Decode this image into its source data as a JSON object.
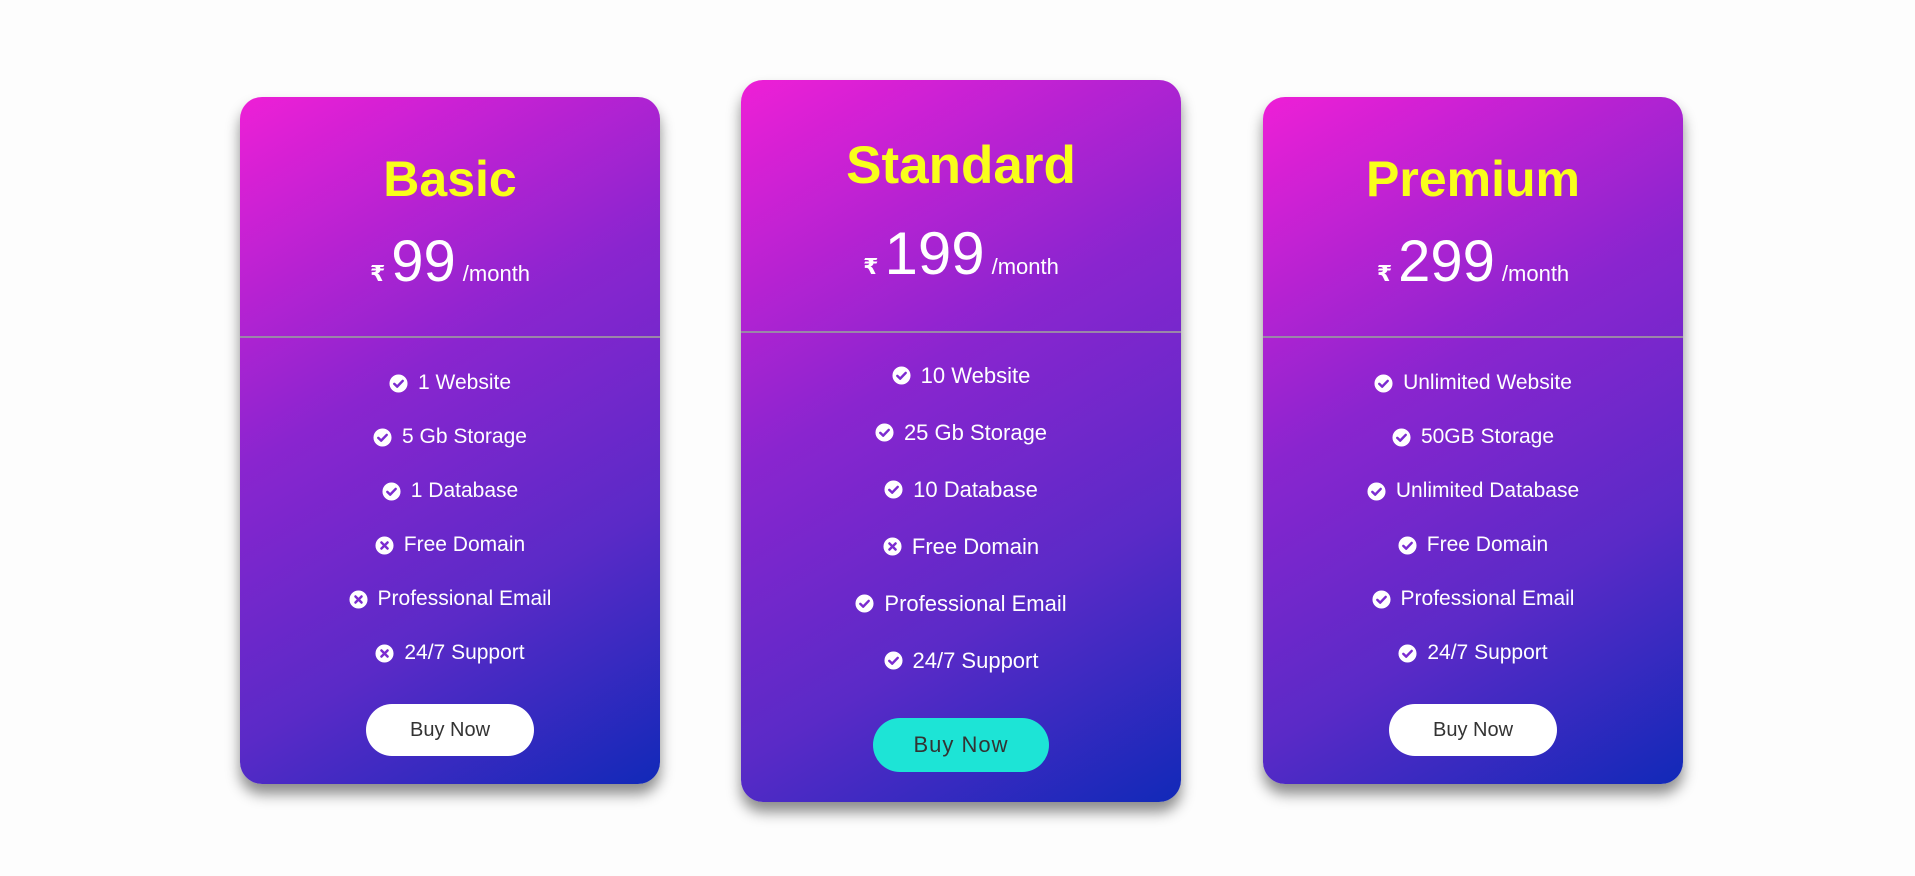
{
  "theme": {
    "gradient_start": "#ee1fd6",
    "gradient_end": "#1129b8",
    "title_color": "#f9ff1a",
    "highlight_button_color": "#1de4d6"
  },
  "plans": [
    {
      "name": "Basic",
      "currency": "₹",
      "price": "99",
      "period": "/month",
      "features": [
        {
          "label": "1 Website",
          "included": true
        },
        {
          "label": "5 Gb Storage",
          "included": true
        },
        {
          "label": "1 Database",
          "included": true
        },
        {
          "label": "Free Domain",
          "included": false
        },
        {
          "label": "Professional Email",
          "included": false
        },
        {
          "label": "24/7 Support",
          "included": false
        }
      ],
      "button_label": "Buy Now"
    },
    {
      "name": "Standard",
      "currency": "₹",
      "price": "199",
      "period": "/month",
      "features": [
        {
          "label": "10 Website",
          "included": true
        },
        {
          "label": "25 Gb Storage",
          "included": true
        },
        {
          "label": "10 Database",
          "included": true
        },
        {
          "label": "Free Domain",
          "included": false
        },
        {
          "label": "Professional Email",
          "included": true
        },
        {
          "label": "24/7 Support",
          "included": true
        }
      ],
      "button_label": "Buy Now"
    },
    {
      "name": "Premium",
      "currency": "₹",
      "price": "299",
      "period": "/month",
      "features": [
        {
          "label": "Unlimited Website",
          "included": true
        },
        {
          "label": "50GB Storage",
          "included": true
        },
        {
          "label": "Unlimited Database",
          "included": true
        },
        {
          "label": "Free Domain",
          "included": true
        },
        {
          "label": "Professional Email",
          "included": true
        },
        {
          "label": "24/7 Support",
          "included": true
        }
      ],
      "button_label": "Buy Now"
    }
  ]
}
